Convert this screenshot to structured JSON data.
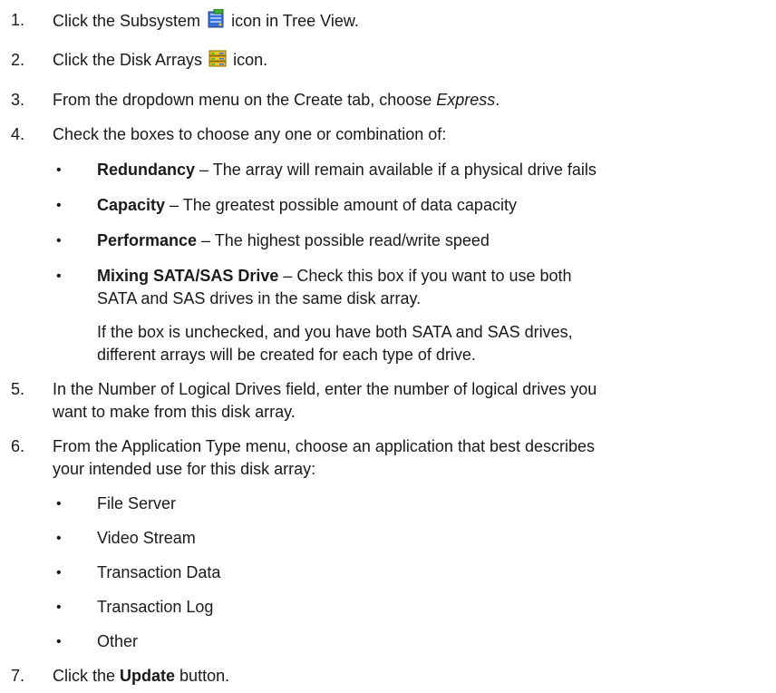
{
  "steps": [
    {
      "num": "1.",
      "pre": "Click the Subsystem",
      "icon": "subsystem-icon",
      "post": "icon in Tree View."
    },
    {
      "num": "2.",
      "pre": "Click the Disk Arrays",
      "icon": "disk-arrays-icon",
      "post": "icon."
    },
    {
      "num": "3.",
      "pre": "From the dropdown menu on the Create tab, choose ",
      "em": "Express",
      "post": "."
    },
    {
      "num": "4.",
      "text": "Check the boxes to choose any one or combination of:"
    },
    {
      "num": "5.",
      "line1": "In the Number of Logical Drives field, enter the number of logical drives you",
      "line2": "want to make from this disk array."
    },
    {
      "num": "6.",
      "line1": "From the Application Type menu, choose an application that best describes",
      "line2": "your intended use for this disk array:"
    },
    {
      "num": "7.",
      "pre": "Click the ",
      "bold": "Update",
      "post": " button."
    }
  ],
  "options": [
    {
      "bullet": "•",
      "term": "Redundancy",
      "desc": " – The array will remain available if a physical drive fails"
    },
    {
      "bullet": "•",
      "term": "Capacity",
      "desc": " – The greatest possible amount of data capacity"
    },
    {
      "bullet": "•",
      "term": "Performance",
      "desc": " – The highest possible read/write speed"
    },
    {
      "bullet": "•",
      "term": "Mixing SATA/SAS Drive",
      "desc": " – Check this box if you want to use both",
      "line2": "SATA and SAS drives in the same disk array."
    }
  ],
  "note": {
    "line1": "If the box is unchecked, and you have both SATA and SAS drives,",
    "line2": "different arrays will be created for each type of drive."
  },
  "app_types": [
    "File Server",
    "Video Stream",
    "Transaction Data",
    "Transaction Log",
    "Other"
  ],
  "bullet": "•",
  "colors": {
    "text": "#1a1a1a",
    "icon_blue": "#3a6fd8",
    "icon_yellow": "#f2c31b",
    "icon_green": "#3fae3a"
  }
}
